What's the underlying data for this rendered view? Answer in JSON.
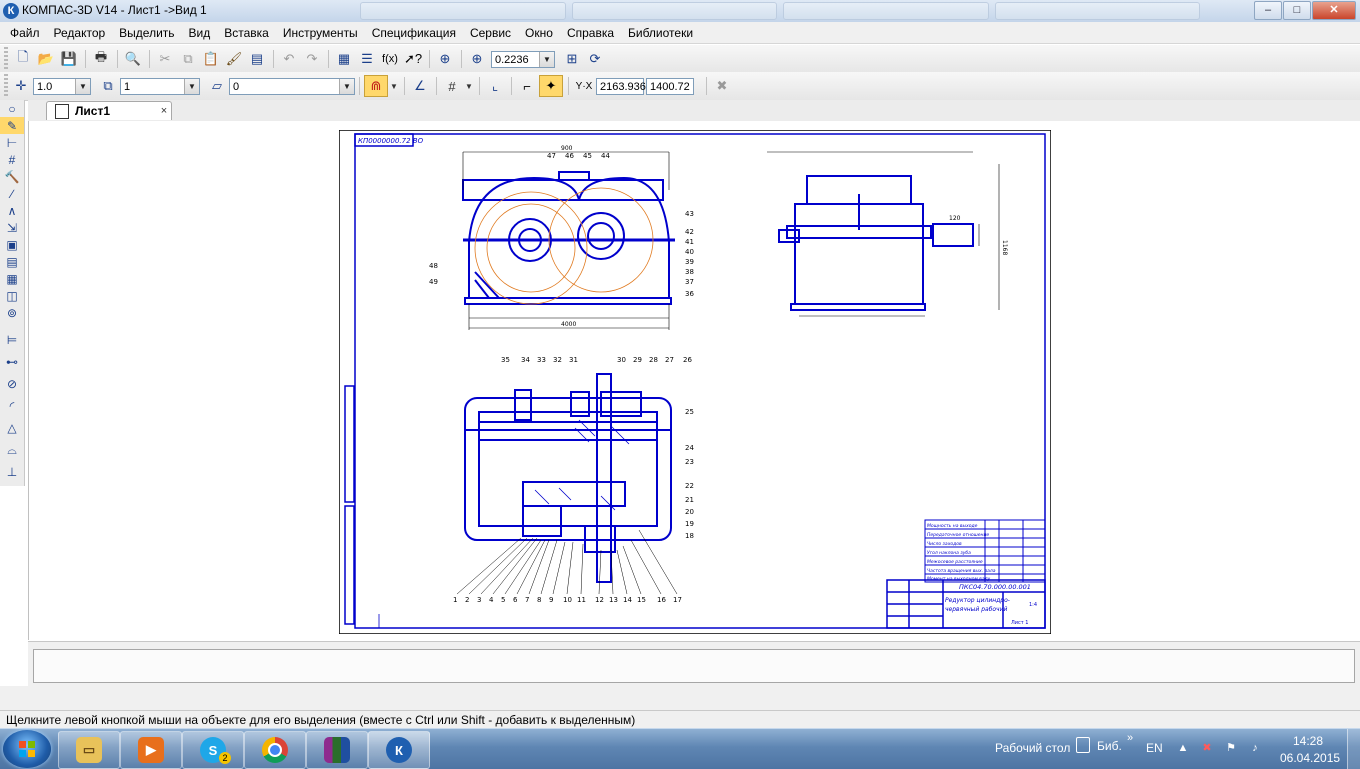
{
  "window": {
    "title": "КОМПАС-3D V14 - Лист1 ->Вид 1",
    "logo": "К",
    "buttons": {
      "minimize": "–",
      "maximize": "□",
      "close": "✕"
    }
  },
  "menu": [
    "Файл",
    "Редактор",
    "Выделить",
    "Вид",
    "Вставка",
    "Инструменты",
    "Спецификация",
    "Сервис",
    "Окно",
    "Справка",
    "Библиотеки"
  ],
  "toolbar_standard": {
    "zoom_value": "0.2236"
  },
  "toolbar_current_state": {
    "line_scale": "1.0",
    "layer_view": "1",
    "layer": "0",
    "coord_x": "2163.936",
    "coord_y": "1400.72"
  },
  "document_tab": {
    "label": "Лист1",
    "close": "×"
  },
  "status_text": "Щелкните левой кнопкой мыши на объекте для его выделения (вместе с Ctrl или Shift - добавить к выделенным)",
  "taskbar": {
    "apps": [
      "explorer",
      "media-player",
      "skype",
      "chrome",
      "winrar",
      "kompas"
    ],
    "skype_badge": "2",
    "desktop_label": "Рабочий стол",
    "lib_label": "Биб.",
    "expand": "»",
    "lang": "EN",
    "time": "14:28",
    "date": "06.04.2015"
  },
  "colors": {
    "drawing": "#0000cc",
    "construction": "#e07a20",
    "tab_active": "#ffd86b"
  },
  "drawing": {
    "stamp_code": "КП0000000.72 ВО",
    "title_block": {
      "designation": "ПКС04.70.000.00.001",
      "name_line1": "Редуктор цилиндро-",
      "name_line2": "червячный рабочий",
      "scale": "1:4",
      "sheet": "Лист 1"
    },
    "table_rows": [
      "Мощность на выходе",
      "Передаточное отношение",
      "Число заходов",
      "Угол наклона зуба",
      "Межосевое расстояние",
      "Частота вращения вых. вала",
      "Момент на выходном валу"
    ],
    "callouts_top": [
      "47",
      "46",
      "45",
      "44"
    ],
    "callouts_right_top": [
      "43",
      "42",
      "41",
      "40",
      "39",
      "38",
      "37",
      "36"
    ],
    "callouts_left_top": [
      "48",
      "49"
    ],
    "callouts_section_top": [
      "35",
      "34",
      "33",
      "32",
      "31",
      "30",
      "29",
      "28",
      "27",
      "26"
    ],
    "callouts_section_right": [
      "25",
      "24",
      "23",
      "22",
      "21",
      "20",
      "19",
      "18"
    ],
    "callouts_bottom": [
      "1",
      "2",
      "3",
      "4",
      "5",
      "6",
      "7",
      "8",
      "9",
      "10",
      "11",
      "12",
      "13",
      "14",
      "15",
      "16",
      "17"
    ],
    "dims": {
      "top_width": "900",
      "total": "4000",
      "right_height": "1168",
      "shaft": "120"
    }
  }
}
